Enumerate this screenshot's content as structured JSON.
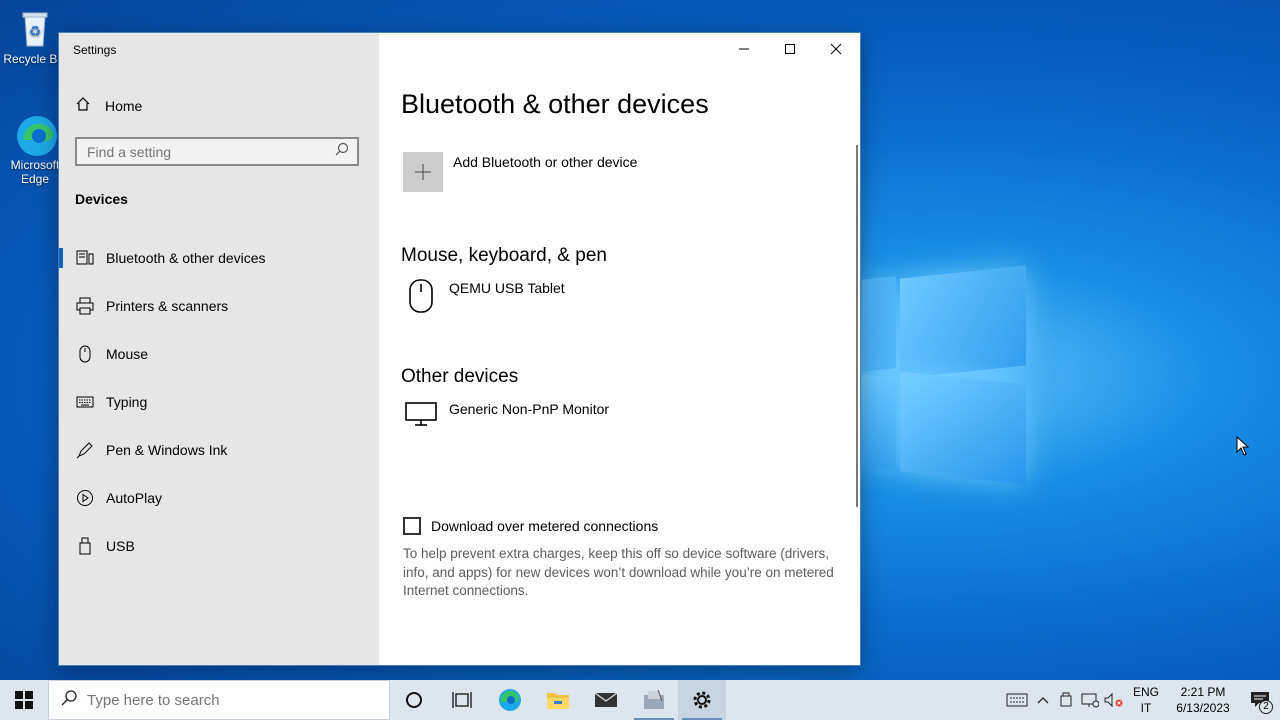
{
  "desktop": {
    "icons": [
      {
        "label": "Recycle Bin"
      },
      {
        "label": "Microsoft Edge"
      }
    ]
  },
  "window": {
    "title": "Settings",
    "controls": {
      "minimize": "minimize",
      "maximize": "maximize",
      "close": "close"
    }
  },
  "sidebar": {
    "home": "Home",
    "search_placeholder": "Find a setting",
    "section": "Devices",
    "items": [
      {
        "label": "Bluetooth & other devices",
        "icon": "bluetooth-icon",
        "active": true
      },
      {
        "label": "Printers & scanners",
        "icon": "printer-icon"
      },
      {
        "label": "Mouse",
        "icon": "mouse-icon"
      },
      {
        "label": "Typing",
        "icon": "keyboard-icon"
      },
      {
        "label": "Pen & Windows Ink",
        "icon": "pen-icon"
      },
      {
        "label": "AutoPlay",
        "icon": "autoplay-icon"
      },
      {
        "label": "USB",
        "icon": "usb-icon"
      }
    ]
  },
  "main": {
    "title": "Bluetooth & other devices",
    "add_device": "Add Bluetooth or other device",
    "groups": [
      {
        "title": "Mouse, keyboard, & pen",
        "devices": [
          {
            "name": "QEMU USB Tablet",
            "icon": "mouse-icon"
          }
        ]
      },
      {
        "title": "Other devices",
        "devices": [
          {
            "name": "Generic Non-PnP Monitor",
            "icon": "monitor-icon"
          }
        ]
      }
    ],
    "metered": {
      "label": "Download over metered connections",
      "checked": false,
      "hint": "To help prevent extra charges, keep this off so device software (drivers, info, and apps) for new devices won’t download while you’re on metered Internet connections."
    }
  },
  "taskbar": {
    "search_placeholder": "Type here to search",
    "lang_top": "ENG",
    "lang_bottom": "IT",
    "time": "2:21 PM",
    "date": "6/13/2023",
    "notifications": "2",
    "colors": {
      "accent": "#0067c0",
      "taskbar": "#dde6ef"
    }
  }
}
